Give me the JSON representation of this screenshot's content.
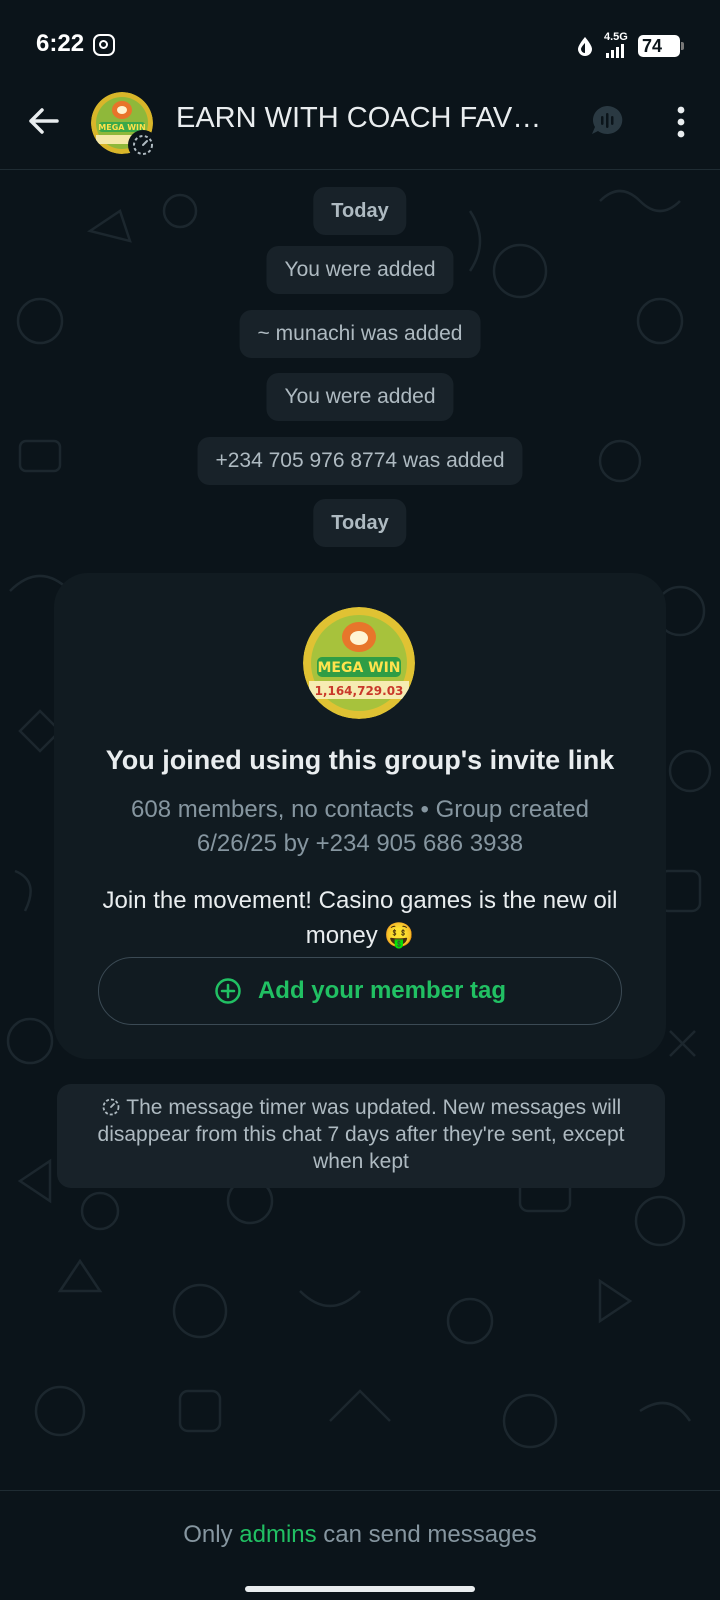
{
  "status_bar": {
    "time": "6:22",
    "network_label": "4.5G",
    "battery": "74"
  },
  "header": {
    "title": "EARN WITH COACH FAVE..."
  },
  "chat": {
    "events": [
      {
        "text": "Today",
        "kind": "date"
      },
      {
        "text": "You were added",
        "kind": "system"
      },
      {
        "text": "~ munachi was added",
        "kind": "system"
      },
      {
        "text": "You were added",
        "kind": "system"
      },
      {
        "text": "+234 705 976 8774 was added",
        "kind": "system"
      },
      {
        "text": "Today",
        "kind": "date"
      }
    ],
    "group_card": {
      "avatar_text_top": "MEGA WIN",
      "avatar_text_bottom": "1,164,729.03",
      "title": "You joined using this group's invite link",
      "meta": "608 members, no contacts • Group created 6/26/25 by +234 905 686 3938",
      "description": "Join the movement! Casino games is the new oil money 🤑",
      "tag_button_label": "Add your member tag"
    },
    "timer_message": "The message timer was updated. New messages will disappear from this chat 7 days after they're sent, except when kept"
  },
  "footer": {
    "prefix": "Only",
    "highlight": "admins",
    "suffix": "can send messages"
  },
  "colors": {
    "background": "#0b141a",
    "bubble": "#182229",
    "card": "#111b21",
    "accent_green": "#21c063"
  }
}
